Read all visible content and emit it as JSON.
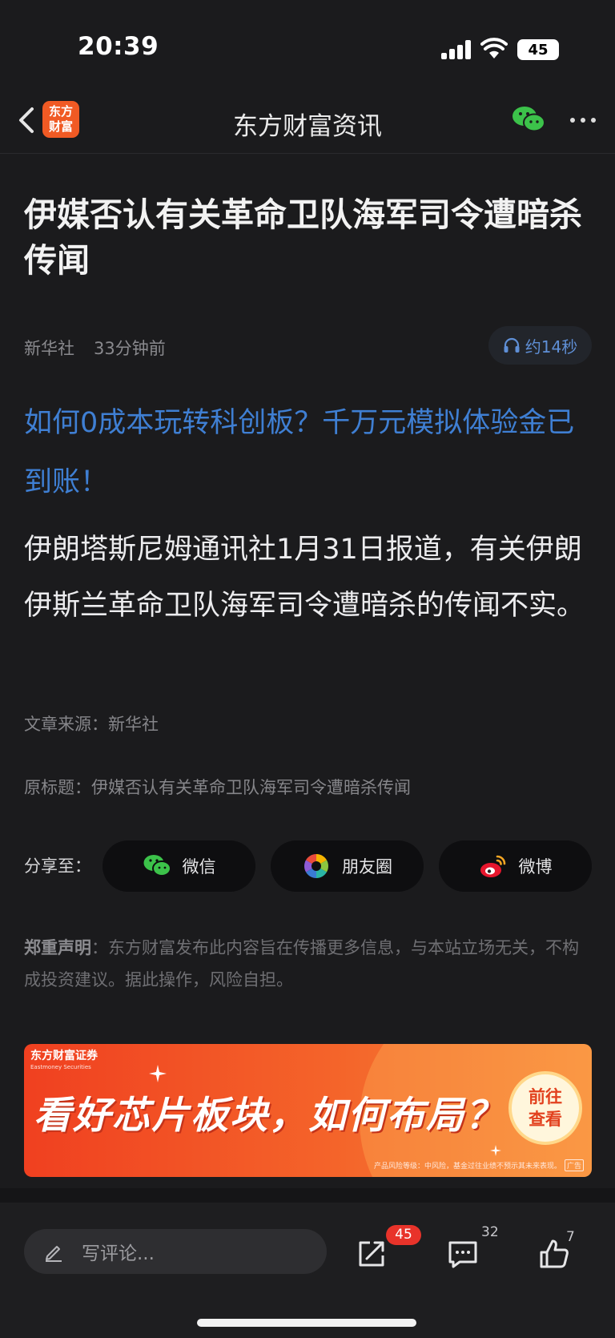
{
  "status": {
    "time": "20:39",
    "battery": "45"
  },
  "nav": {
    "logo_line1": "东方",
    "logo_line2": "财富",
    "title": "东方财富资讯"
  },
  "article": {
    "title": "伊媒否认有关革命卫队海军司令遭暗杀传闻",
    "source": "新华社",
    "time_ago": "33分钟前",
    "audio_label": "约14秒",
    "promo_link": "如何0成本玩转科创板？千万元模拟体验金已到账！",
    "body": "伊朗塔斯尼姆通讯社1月31日报道，有关伊朗伊斯兰革命卫队海军司令遭暗杀的传闻不实。",
    "article_source": "文章来源：新华社",
    "original_title": "原标题：伊媒否认有关革命卫队海军司令遭暗杀传闻"
  },
  "share": {
    "label": "分享至：",
    "wechat": "微信",
    "moments": "朋友圈",
    "weibo": "微博"
  },
  "disclaimer": {
    "heading": "郑重声明",
    "text": "：东方财富发布此内容旨在传播更多信息，与本站立场无关，不构成投资建议。据此操作，风险自担。"
  },
  "ad": {
    "brand": "东方财富证券",
    "brand_en": "Eastmoney Securities",
    "headline": "看好芯片板块，如何布局？",
    "cta_line1": "前往",
    "cta_line2": "查看",
    "risk_note": "产品风险等级：中风险，基金过往业绩不预示其未来表现。",
    "tag": "广告"
  },
  "bottom": {
    "comment_placeholder": "写评论...",
    "share_count": "45",
    "comment_count": "32",
    "like_count": "7"
  },
  "colors": {
    "accent_blue": "#3f7fd3",
    "brand_orange": "#f05a24",
    "badge_red": "#e8332a",
    "wechat_green": "#3cc24a"
  }
}
